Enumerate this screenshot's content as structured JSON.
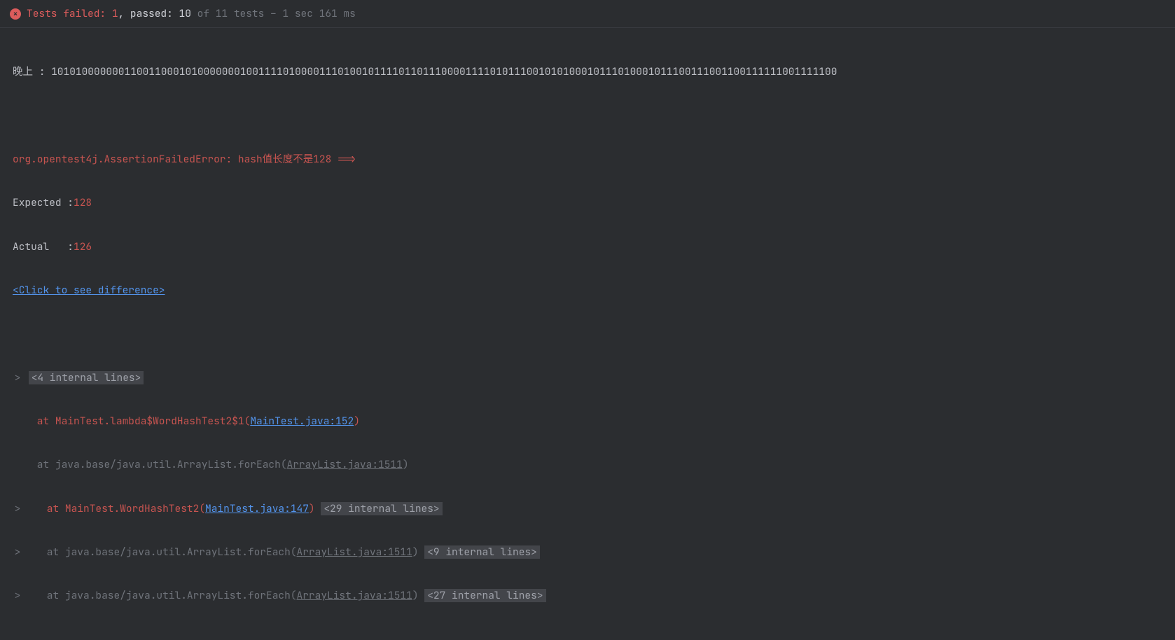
{
  "header": {
    "failed_label": "Tests failed: ",
    "failed_count": "1",
    "passed_label": ", passed: ",
    "passed_count": "10",
    "summary_tail": " of 11 tests – 1 sec 161 ms"
  },
  "output": {
    "line1_label": "晚上 : ",
    "line1_value": "101010000000110011000101000000010011110100001110100101111011011100001111010111001010100010111010001011100111001100111111001111100",
    "error_line": "org.opentest4j.AssertionFailedError: hash值长度不是128 ==>",
    "expected_label": "Expected :",
    "expected_value": "128",
    "actual_label": "Actual   :",
    "actual_value": "126",
    "diff_link": "<Click to see difference>",
    "collapse_marker": ">",
    "internal_badge_1": "<4 internal lines>",
    "stack1_at": "    at ",
    "stack1_text": "MainTest.lambda$WordHashTest2$1(",
    "stack1_link": "MainTest.java:152",
    "stack1_close": ")",
    "stack2_at": "    at ",
    "stack2_text": "java.base/java.util.ArrayList.forEach(",
    "stack2_link": "ArrayList.java:1511",
    "stack2_close": ")",
    "stack3_at": "    at ",
    "stack3_text": "MainTest.WordHashTest2(",
    "stack3_link": "MainTest.java:147",
    "stack3_close": ")",
    "stack3_badge": "<29 internal lines>",
    "stack4_at": "    at ",
    "stack4_text": "java.base/java.util.ArrayList.forEach(",
    "stack4_link": "ArrayList.java:1511",
    "stack4_close": ")",
    "stack4_badge": "<9 internal lines>",
    "stack5_at": "    at ",
    "stack5_text": "java.base/java.util.ArrayList.forEach(",
    "stack5_link": "ArrayList.java:1511",
    "stack5_close": ")",
    "stack5_badge": "<27 internal lines>"
  }
}
